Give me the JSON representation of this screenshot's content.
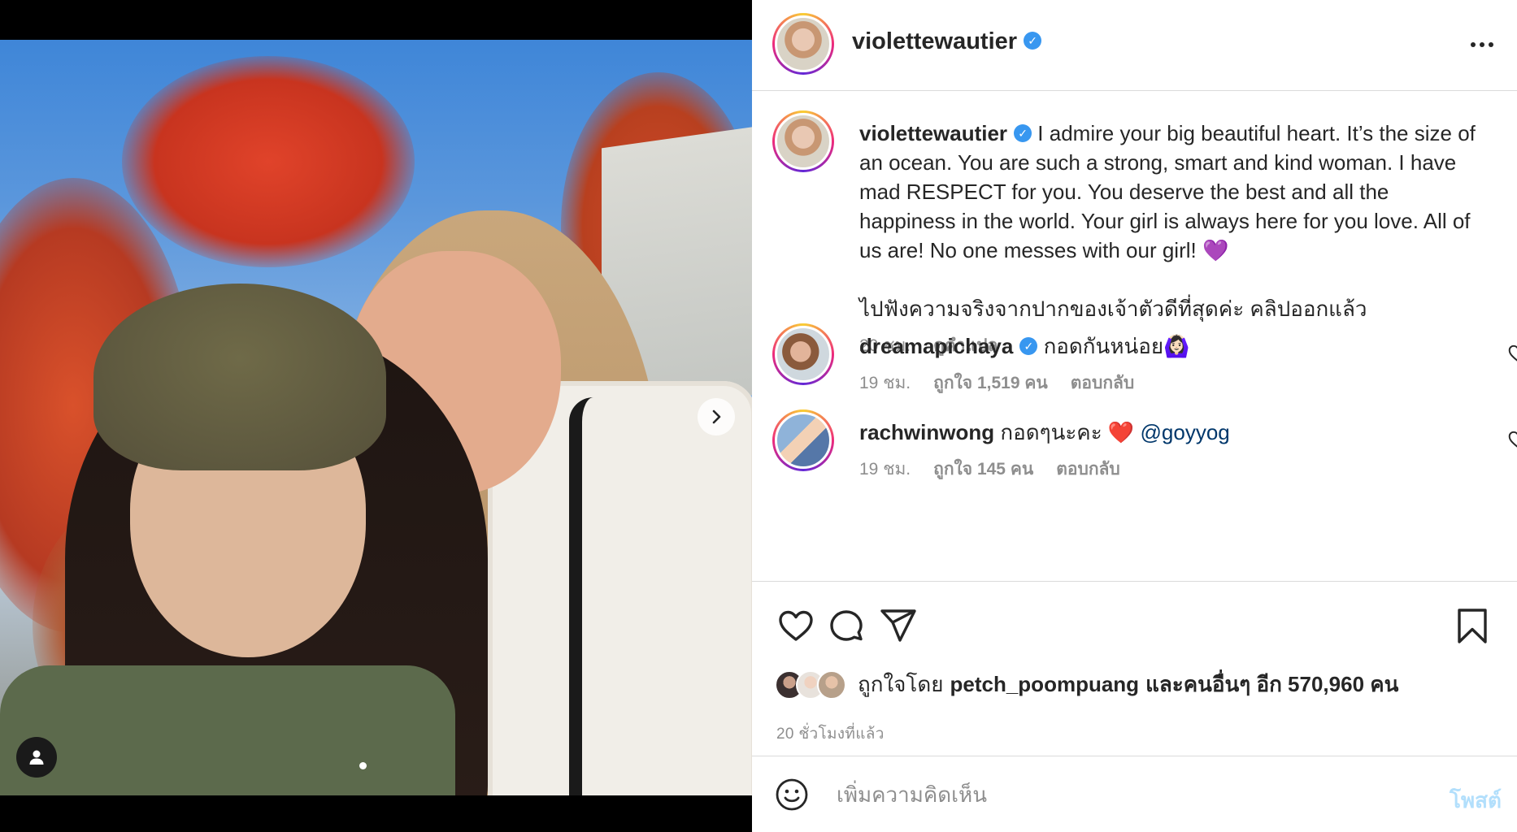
{
  "post": {
    "username": "violettewautier",
    "verified": true
  },
  "caption": {
    "username": "violettewautier",
    "text_en": "I admire your big beautiful heart. It’s the size of an ocean. You are such a strong, smart and kind woman. I have mad RESPECT for you. You deserve the best and all the happiness in the world. Your girl is always here for you love. All of us are! No one messes with our girl! 💜",
    "text_th": "ไปฟังความจริงจากปากของเจ้าตัวดีที่สุดค่ะ คลิปออกแล้ว",
    "time": "20 ชม.",
    "translate_label": "ดูคำแปล"
  },
  "comments": [
    {
      "username": "dreamapichaya",
      "verified": true,
      "text": "กอดกันหน่อย🙆🏻‍♀️",
      "time": "19 ชม.",
      "likes": "ถูกใจ 1,519 คน",
      "reply_label": "ตอบกลับ"
    },
    {
      "username": "rachwinwong",
      "verified": false,
      "text": "กอดๆนะคะ ❤️",
      "mention": "@goyyog",
      "time": "19 ชม.",
      "likes": "ถูกใจ 145 คน",
      "reply_label": "ตอบกลับ"
    }
  ],
  "likes": {
    "prefix": "ถูกใจโดย",
    "user": "petch_poompuang",
    "suffix": "และคนอื่นๆ อีก 570,960 คน"
  },
  "time_ago": "20 ชั่วโมงที่แล้ว",
  "add_comment": {
    "placeholder": "เพิ่มความคิดเห็น",
    "post_label": "โพสต์"
  },
  "carousel": {
    "total": 1,
    "active_index": 0
  },
  "colors": {
    "verified": "#3897f0",
    "link": "#00376b",
    "muted": "#8e8e8e",
    "post_button_disabled": "#b2dffc"
  },
  "icons": [
    "more-icon",
    "chevron-right-icon",
    "user-tag-icon",
    "heart-icon",
    "comment-icon",
    "share-icon",
    "bookmark-icon",
    "emoji-icon",
    "verified-icon"
  ]
}
